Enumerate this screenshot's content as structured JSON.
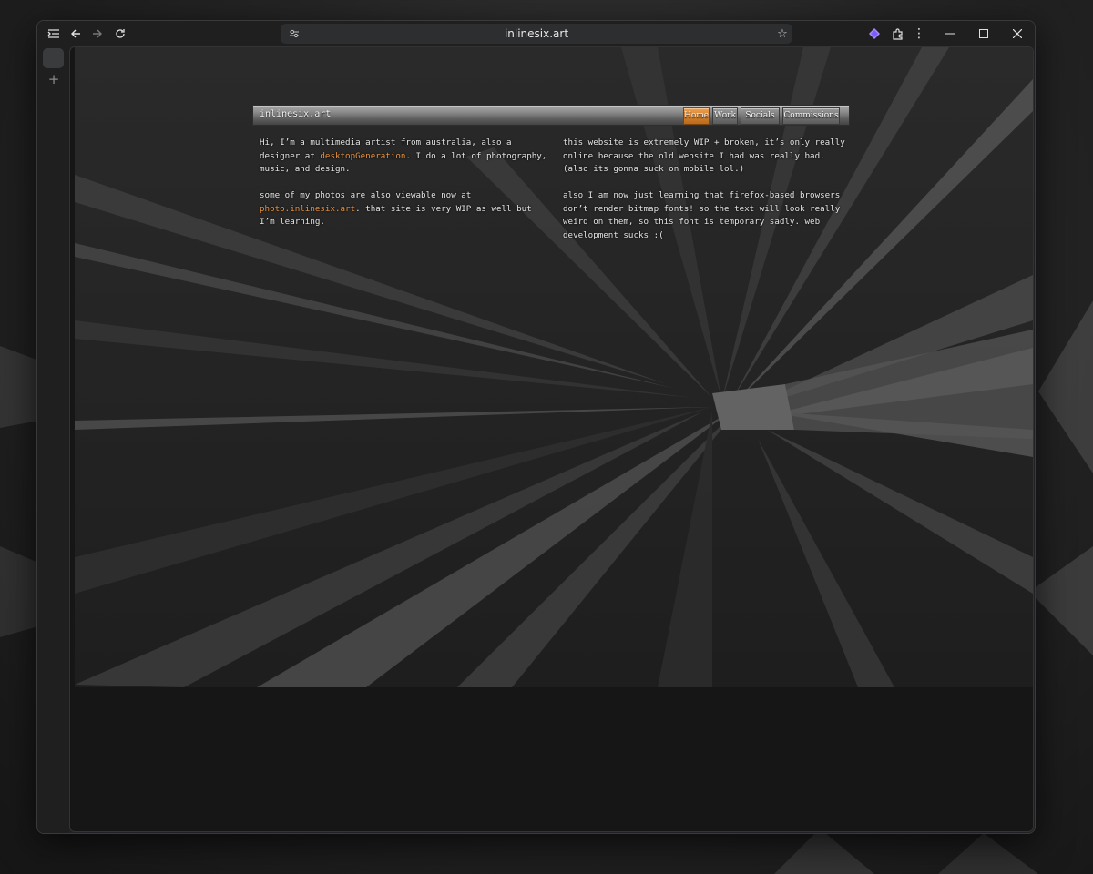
{
  "browser": {
    "url": "inlinesix.art",
    "icons": {
      "sidebar": "sidebar-toggle-icon",
      "back": "back-arrow-icon",
      "forward": "forward-arrow-icon",
      "reload": "reload-icon",
      "site_settings": "tune-icon",
      "bookmark": "star-icon",
      "extension": "gemini-icon",
      "extensions": "puzzle-icon",
      "menu": "kebab-menu-icon",
      "minimize": "minimize-icon",
      "maximize": "maximize-icon",
      "close": "close-icon",
      "new_tab": "plus-icon"
    }
  },
  "site": {
    "title": "inlinesix.art",
    "nav": [
      {
        "label": "Home",
        "active": true
      },
      {
        "label": "Work",
        "active": false
      },
      {
        "label": "Socials",
        "active": false
      },
      {
        "label": "Commissions",
        "active": false
      }
    ],
    "accent_color": "#e8913e",
    "left": {
      "p1_a": "Hi, I’m a multimedia artist from australia, also a designer at ",
      "p1_link": "desktopGeneration",
      "p1_b": ". I do a lot of photography, music, and design.",
      "p2_a": "some of my photos are also viewable now at ",
      "p2_link": "photo.inlinesix.art",
      "p2_b": ". that site is very WIP as well but I’m learning."
    },
    "right": {
      "p1": "this website is extremely WIP + broken, it’s only really online because the old website I had was really bad. (also its gonna suck on mobile lol.)",
      "p2": "also I am now just learning that firefox-based browsers don’t render bitmap fonts! so the text will look really weird on them, so this font is temporary sadly. web development sucks :("
    }
  }
}
